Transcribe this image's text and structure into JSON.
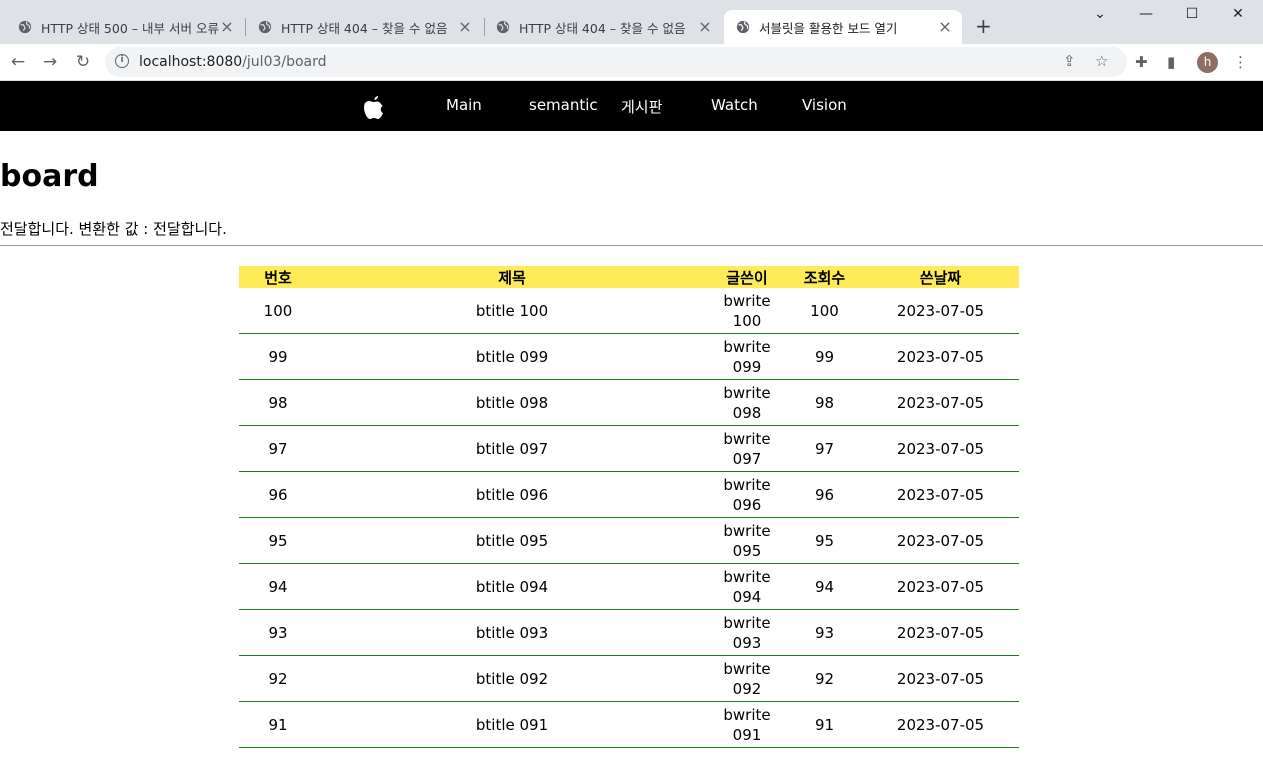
{
  "browser": {
    "tabs": [
      {
        "title": "HTTP 상태 500 – 내부 서버 오류",
        "active": false
      },
      {
        "title": "HTTP 상태 404 – 찾을 수 없음",
        "active": false
      },
      {
        "title": "HTTP 상태 404 – 찾을 수 없음",
        "active": false
      },
      {
        "title": "서블릿을 활용한 보드 열기",
        "active": true
      }
    ],
    "url_host": "localhost:8080",
    "url_path": "/jul03/board",
    "profile_initial": "h"
  },
  "nav": {
    "items": [
      "Main",
      "semantic",
      "게시판",
      "Watch",
      "Vision"
    ]
  },
  "page": {
    "heading": "board",
    "message": "전달합니다. 변환한 값 : 전달합니다."
  },
  "table": {
    "headers": [
      "번호",
      "제목",
      "글쓴이",
      "조회수",
      "쓴날짜"
    ],
    "rows": [
      {
        "no": "100",
        "title": "btitle 100",
        "writer": "bwrite 100",
        "hits": "100",
        "date": "2023-07-05"
      },
      {
        "no": "99",
        "title": "btitle 099",
        "writer": "bwrite 099",
        "hits": "99",
        "date": "2023-07-05"
      },
      {
        "no": "98",
        "title": "btitle 098",
        "writer": "bwrite 098",
        "hits": "98",
        "date": "2023-07-05"
      },
      {
        "no": "97",
        "title": "btitle 097",
        "writer": "bwrite 097",
        "hits": "97",
        "date": "2023-07-05"
      },
      {
        "no": "96",
        "title": "btitle 096",
        "writer": "bwrite 096",
        "hits": "96",
        "date": "2023-07-05"
      },
      {
        "no": "95",
        "title": "btitle 095",
        "writer": "bwrite 095",
        "hits": "95",
        "date": "2023-07-05"
      },
      {
        "no": "94",
        "title": "btitle 094",
        "writer": "bwrite 094",
        "hits": "94",
        "date": "2023-07-05"
      },
      {
        "no": "93",
        "title": "btitle 093",
        "writer": "bwrite 093",
        "hits": "93",
        "date": "2023-07-05"
      },
      {
        "no": "92",
        "title": "btitle 092",
        "writer": "bwrite 092",
        "hits": "92",
        "date": "2023-07-05"
      },
      {
        "no": "91",
        "title": "btitle 091",
        "writer": "bwrite 091",
        "hits": "91",
        "date": "2023-07-05"
      }
    ]
  },
  "colors": {
    "nav_bg": "#000000",
    "header_row_bg": "#ffeb57",
    "row_border": "#1e7a1e"
  },
  "icons": {
    "tab_favicon": "globe-icon",
    "logo": "apple-logo-icon"
  }
}
